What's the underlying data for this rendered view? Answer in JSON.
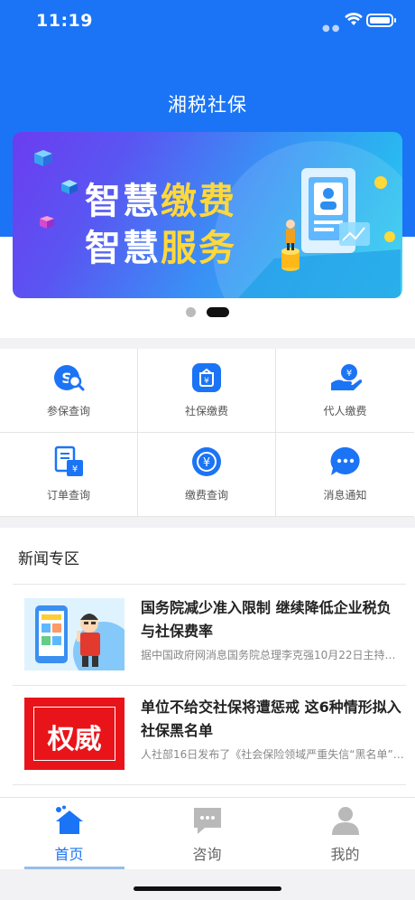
{
  "status_bar": {
    "time": "11:19"
  },
  "header": {
    "title": "湘税社保"
  },
  "banner": {
    "line1_a": "智慧",
    "line1_b": "缴费",
    "line2_a": "智慧",
    "line2_b": "服务",
    "active_page": 2,
    "page_count": 2
  },
  "services": [
    {
      "label": "参保查询",
      "icon": "search-card-icon"
    },
    {
      "label": "社保缴费",
      "icon": "wallet-icon"
    },
    {
      "label": "代人缴费",
      "icon": "hand-coin-icon"
    },
    {
      "label": "订单查询",
      "icon": "order-doc-icon"
    },
    {
      "label": "缴费查询",
      "icon": "yuan-circle-icon"
    },
    {
      "label": "消息通知",
      "icon": "chat-bubble-icon"
    }
  ],
  "news": {
    "section_title": "新闻专区",
    "items": [
      {
        "headline": "国务院减少准入限制 继续降低企业税负与社保费率",
        "summary": "据中国政府网消息国务院总理李克强10月22日主持…"
      },
      {
        "headline": "单位不给交社保将遭惩戒 这6种情形拟入社保黑名单",
        "summary": "人社部16日发布了《社会保险领域严重失信“黑名单”…",
        "thumb_text": "权威"
      }
    ]
  },
  "tabbar": {
    "tabs": [
      {
        "label": "首页",
        "icon": "home-icon",
        "active": true
      },
      {
        "label": "咨询",
        "icon": "consult-icon",
        "active": false
      },
      {
        "label": "我的",
        "icon": "user-icon",
        "active": false
      }
    ]
  },
  "colors": {
    "primary": "#1b74f5",
    "banner_highlight": "#ffd83a",
    "authority_red": "#e8141a"
  }
}
